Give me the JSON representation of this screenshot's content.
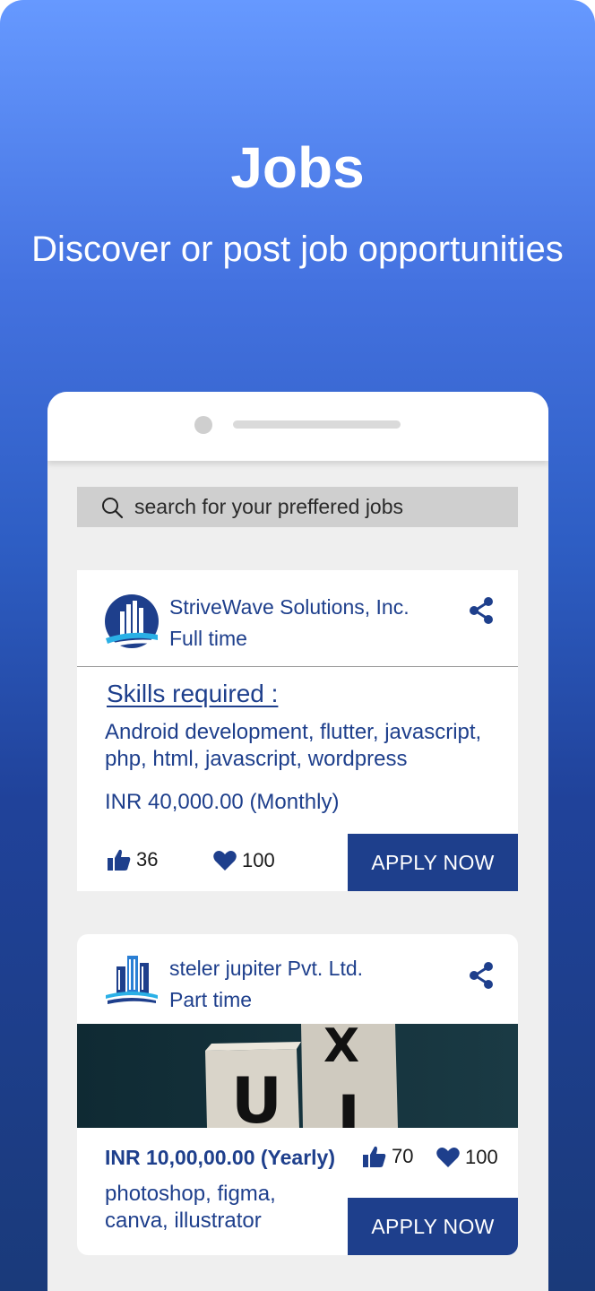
{
  "header": {
    "title": "Jobs",
    "subtitle": "Discover or post job opportunities"
  },
  "search": {
    "placeholder": "search for your preffered jobs"
  },
  "jobs": [
    {
      "company": "StriveWave Solutions, Inc.",
      "type": "Full time",
      "skills_title": "Skills required :",
      "skills": "Android development, flutter, javascript, php, html, javascript, wordpress",
      "salary": "INR 40,000.00 (Monthly)",
      "likes": "36",
      "favorites": "100",
      "apply_label": "APPLY NOW"
    },
    {
      "company": "steler jupiter Pvt. Ltd.",
      "type": "Part time",
      "salary": "INR 10,00,00.00 (Yearly)",
      "skills": "photoshop, figma, canva, illustrator",
      "likes": "70",
      "favorites": "100",
      "apply_label": "APPLY NOW",
      "banner_letters": [
        "U",
        "I",
        "X"
      ]
    }
  ],
  "colors": {
    "primary": "#1e3f8c",
    "gradient_top": "#6699ff",
    "gradient_bottom": "#1a3a7a",
    "card_bg": "#ffffff",
    "phone_bg": "#efefef"
  }
}
